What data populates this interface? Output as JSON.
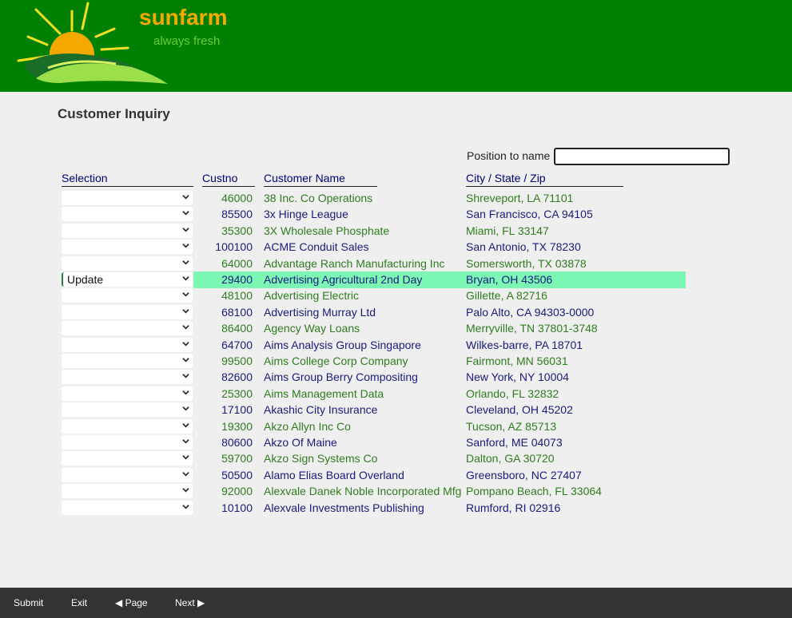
{
  "brand": {
    "name": "sunfarm",
    "tagline": "always fresh"
  },
  "page": {
    "title": "Customer Inquiry"
  },
  "position": {
    "label": "Position to name",
    "value": ""
  },
  "columns": {
    "selection": "Selection",
    "custno": "Custno",
    "name": "Customer Name",
    "city": "City / State / Zip"
  },
  "colors": {
    "header_bg": "#008000",
    "highlight": "#7df7b4",
    "footer_bg": "#333333"
  },
  "rows": [
    {
      "selection": "",
      "custno": "46000",
      "name": "38 Inc. Co Operations",
      "city": "Shreveport, LA 71101"
    },
    {
      "selection": "",
      "custno": "85500",
      "name": "3x Hinge League",
      "city": "San Francisco, CA 94105"
    },
    {
      "selection": "",
      "custno": "35300",
      "name": "3X Wholesale Phosphate",
      "city": "Miami, FL 33147"
    },
    {
      "selection": "",
      "custno": "100100",
      "name": "ACME Conduit Sales",
      "city": "San Antonio, TX 78230"
    },
    {
      "selection": "",
      "custno": "64000",
      "name": "Advantage Ranch Manufacturing Inc",
      "city": "Somersworth, TX 03878"
    },
    {
      "selection": "Update",
      "custno": "29400",
      "name": "Advertising Agricultural 2nd Day",
      "city": "Bryan, OH 43506",
      "selected": true
    },
    {
      "selection": "",
      "custno": "48100",
      "name": "Advertising Electric",
      "city": "Gillette, A 82716"
    },
    {
      "selection": "",
      "custno": "68100",
      "name": "Advertising Murray Ltd",
      "city": "Palo Alto, CA 94303-0000"
    },
    {
      "selection": "",
      "custno": "86400",
      "name": "Agency Way Loans",
      "city": "Merryville, TN 37801-3748"
    },
    {
      "selection": "",
      "custno": "64700",
      "name": "Aims Analysis Group Singapore",
      "city": "Wilkes-barre, PA 18701"
    },
    {
      "selection": "",
      "custno": "99500",
      "name": "Aims College Corp Company",
      "city": "Fairmont, MN 56031"
    },
    {
      "selection": "",
      "custno": "82600",
      "name": "Aims Group Berry Compositing",
      "city": "New York, NY 10004"
    },
    {
      "selection": "",
      "custno": "25300",
      "name": "Aims Management Data",
      "city": "Orlando, FL 32832"
    },
    {
      "selection": "",
      "custno": "17100",
      "name": "Akashic City Insurance",
      "city": "Cleveland, OH 45202"
    },
    {
      "selection": "",
      "custno": "19300",
      "name": "Akzo Allyn Inc Co",
      "city": "Tucson, AZ 85713"
    },
    {
      "selection": "",
      "custno": "80600",
      "name": "Akzo Of Maine",
      "city": "Sanford, ME 04073"
    },
    {
      "selection": "",
      "custno": "59700",
      "name": "Akzo Sign Systems Co",
      "city": "Dalton, GA 30720"
    },
    {
      "selection": "",
      "custno": "50500",
      "name": "Alamo Elias Board Overland",
      "city": "Greensboro, NC 27407"
    },
    {
      "selection": "",
      "custno": "92000",
      "name": "Alexvale Danek Noble Incorporated Mfg",
      "city": "Pompano Beach, FL 33064"
    },
    {
      "selection": "",
      "custno": "10100",
      "name": "Alexvale Investments Publishing",
      "city": "Rumford, RI 02916"
    }
  ],
  "footer": {
    "submit": "Submit",
    "exit": "Exit",
    "page_up": "◀ Page",
    "page_down": "Next ▶"
  }
}
